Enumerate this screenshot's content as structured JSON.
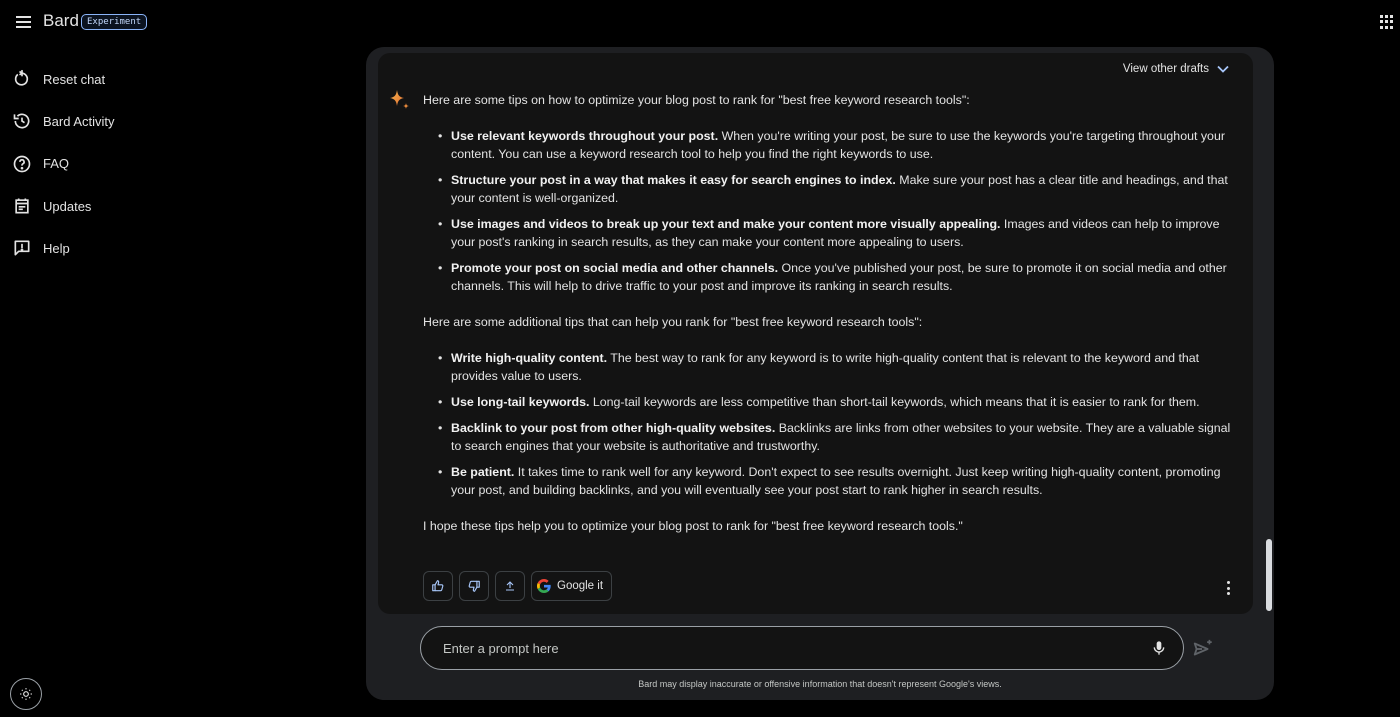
{
  "header": {
    "app_name": "Bard",
    "badge": "Experiment",
    "menu_icon": "hamburger-menu-icon",
    "apps_icon": "google-apps-grid-icon"
  },
  "sidebar": {
    "items": [
      {
        "label": "Reset chat",
        "icon": "reset-icon"
      },
      {
        "label": "Bard Activity",
        "icon": "history-icon"
      },
      {
        "label": "FAQ",
        "icon": "help-circle-icon"
      },
      {
        "label": "Updates",
        "icon": "calendar-icon"
      },
      {
        "label": "Help",
        "icon": "feedback-icon"
      }
    ],
    "theme_icon": "brightness-icon"
  },
  "response": {
    "view_drafts_label": "View other drafts",
    "intro": "Here are some tips on how to optimize your blog post to rank for \"best free keyword research tools\":",
    "tips": [
      {
        "bold": "Use relevant keywords throughout your post.",
        "text": " When you're writing your post, be sure to use the keywords you're targeting throughout your content. You can use a keyword research tool to help you find the right keywords to use."
      },
      {
        "bold": "Structure your post in a way that makes it easy for search engines to index.",
        "text": " Make sure your post has a clear title and headings, and that your content is well-organized."
      },
      {
        "bold": "Use images and videos to break up your text and make your content more visually appealing.",
        "text": " Images and videos can help to improve your post's ranking in search results, as they can make your content more appealing to users."
      },
      {
        "bold": "Promote your post on social media and other channels.",
        "text": " Once you've published your post, be sure to promote it on social media and other channels. This will help to drive traffic to your post and improve its ranking in search results."
      }
    ],
    "additional_intro": "Here are some additional tips that can help you rank for \"best free keyword research tools\":",
    "additional_tips": [
      {
        "bold": "Write high-quality content.",
        "text": " The best way to rank for any keyword is to write high-quality content that is relevant to the keyword and that provides value to users."
      },
      {
        "bold": "Use long-tail keywords.",
        "text": " Long-tail keywords are less competitive than short-tail keywords, which means that it is easier to rank for them."
      },
      {
        "bold": "Backlink to your post from other high-quality websites.",
        "text": " Backlinks are links from other websites to your website. They are a valuable signal to search engines that your website is authoritative and trustworthy."
      },
      {
        "bold": "Be patient.",
        "text": " It takes time to rank well for any keyword. Don't expect to see results overnight. Just keep writing high-quality content, promoting your post, and building backlinks, and you will eventually see your post start to rank higher in search results."
      }
    ],
    "closing": "I hope these tips help you to optimize your blog post to rank for \"best free keyword research tools.\"",
    "actions": {
      "google_it_label": "Google it"
    }
  },
  "input": {
    "placeholder": "Enter a prompt here",
    "value": ""
  },
  "disclaimer": "Bard may display inaccurate or offensive information that doesn't represent Google's views.",
  "colors": {
    "background": "#000000",
    "panel": "#1e1f22",
    "response_bg": "#131313",
    "text": "#e3e3e3",
    "accent": "#8ab4f8"
  }
}
